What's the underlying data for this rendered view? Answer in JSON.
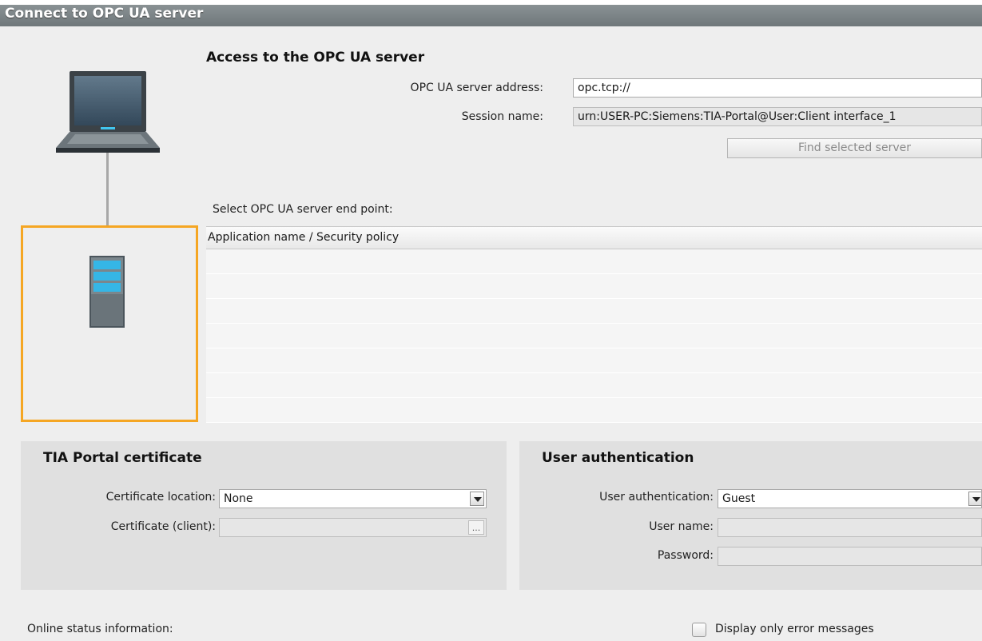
{
  "window": {
    "title": "Connect to OPC UA server"
  },
  "access": {
    "heading": "Access to the OPC UA server",
    "address_label": "OPC UA server address:",
    "address_value": "opc.tcp://",
    "session_label": "Session name:",
    "session_value": "urn:USER-PC:Siemens:TIA-Portal@User:Client interface_1",
    "find_button": "Find selected server"
  },
  "endpoint": {
    "label": "Select OPC UA server end point:",
    "column_header": "Application name / Security policy"
  },
  "certificate": {
    "heading": "TIA Portal certificate",
    "location_label": "Certificate location:",
    "location_value": "None",
    "client_label": "Certificate (client):",
    "browse_button": "..."
  },
  "auth": {
    "heading": "User authentication",
    "type_label": "User authentication:",
    "type_value": "Guest",
    "username_label": "User name:",
    "password_label": "Password:"
  },
  "footer": {
    "status_label": "Online status information:",
    "error_only_label": "Display only error messages"
  },
  "colors": {
    "selection": "#f5a623",
    "titlebar": "#7a8284",
    "screen": "#2f4a5e",
    "server_accent": "#35b6e6"
  },
  "icons": [
    "laptop-icon",
    "server-icon",
    "dropdown-arrow-icon"
  ]
}
